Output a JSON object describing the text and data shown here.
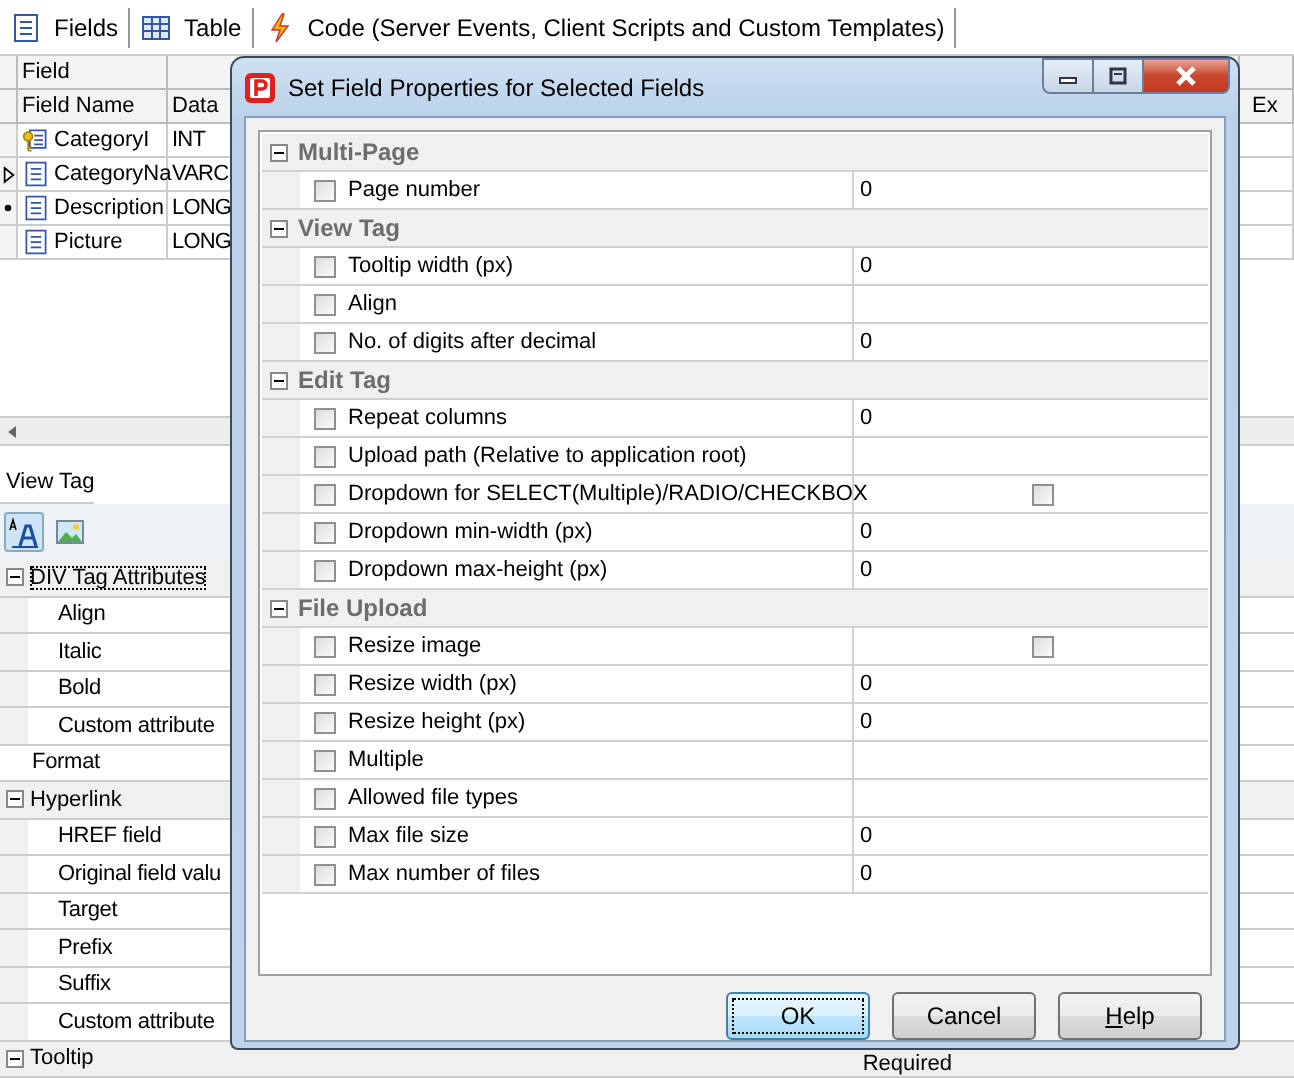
{
  "toolbar_tabs": [
    {
      "label": "Fields"
    },
    {
      "label": "Table"
    },
    {
      "label": "Code (Server Events, Client Scripts and Custom Templates)"
    }
  ],
  "fields_grid": {
    "group_header": "Field",
    "columns": [
      "Field Name",
      "Data"
    ],
    "right_header": "Ex",
    "rows": [
      {
        "name": "CategoryI",
        "type": "INT",
        "kind": "key",
        "selected": false,
        "marked": false
      },
      {
        "name": "CategoryNa",
        "type": "VARC",
        "kind": "field",
        "selected": true,
        "marked": false
      },
      {
        "name": "Description",
        "type": "LONG",
        "kind": "field",
        "selected": false,
        "marked": true
      },
      {
        "name": "Picture",
        "type": "LONG",
        "kind": "field",
        "selected": false,
        "marked": false
      }
    ]
  },
  "view_tag": {
    "title": "View Tag"
  },
  "property_grid": [
    {
      "title": "DIV Tag Attributes",
      "kind": "category",
      "focused": true,
      "children": [
        {
          "label": "Align"
        },
        {
          "label": "Italic"
        },
        {
          "label": "Bold"
        },
        {
          "label": "Custom attribute"
        }
      ]
    },
    {
      "title": "Format",
      "kind": "item",
      "focused": false
    },
    {
      "title": "Hyperlink",
      "kind": "category",
      "focused": false,
      "children": [
        {
          "label": "HREF field"
        },
        {
          "label": "Original field valu"
        },
        {
          "label": "Target"
        },
        {
          "label": "Prefix"
        },
        {
          "label": "Suffix"
        },
        {
          "label": "Custom attribute"
        }
      ]
    },
    {
      "title": "Tooltip",
      "kind": "category",
      "focused": false,
      "value": "Required"
    }
  ],
  "dialog": {
    "title": "Set Field Properties for Selected Fields",
    "sections": [
      {
        "title": "Multi-Page",
        "expanded": true,
        "rows": [
          {
            "label": "Page number",
            "checked": false,
            "kind": "text",
            "value": "0"
          }
        ]
      },
      {
        "title": "View Tag",
        "expanded": true,
        "rows": [
          {
            "label": "Tooltip width (px)",
            "checked": false,
            "kind": "text",
            "value": "0"
          },
          {
            "label": "Align",
            "checked": false,
            "kind": "text"
          },
          {
            "label": "No. of digits after decimal",
            "checked": false,
            "kind": "text",
            "value": "0"
          }
        ]
      },
      {
        "title": "Edit Tag",
        "expanded": true,
        "rows": [
          {
            "label": "Repeat columns",
            "checked": false,
            "kind": "text",
            "value": "0"
          },
          {
            "label": "Upload path (Relative to application root)",
            "checked": false,
            "kind": "text"
          },
          {
            "label": "Dropdown for SELECT(Multiple)/RADIO/CHECKBOX",
            "checked": false,
            "kind": "checkbox",
            "value_checked": false
          },
          {
            "label": "Dropdown min-width (px)",
            "checked": false,
            "kind": "text",
            "value": "0"
          },
          {
            "label": "Dropdown max-height (px)",
            "checked": false,
            "kind": "text",
            "value": "0"
          }
        ]
      },
      {
        "title": "File Upload",
        "expanded": true,
        "rows": [
          {
            "label": "Resize image",
            "checked": false,
            "kind": "checkbox",
            "value_checked": false
          },
          {
            "label": "Resize width (px)",
            "checked": false,
            "kind": "text",
            "value": "0"
          },
          {
            "label": "Resize height (px)",
            "checked": false,
            "kind": "text",
            "value": "0"
          },
          {
            "label": "Multiple",
            "checked": false,
            "kind": "text"
          },
          {
            "label": "Allowed file types",
            "checked": false,
            "kind": "text"
          },
          {
            "label": "Max file size",
            "checked": false,
            "kind": "text",
            "value": "0"
          },
          {
            "label": "Max number of files",
            "checked": false,
            "kind": "text",
            "value": "0"
          }
        ]
      }
    ],
    "buttons": [
      {
        "label": "OK",
        "default": true,
        "mnemonic": false
      },
      {
        "label": "Cancel",
        "default": false,
        "mnemonic": false
      },
      {
        "label": "Help",
        "default": false,
        "mnemonic": true
      }
    ]
  }
}
